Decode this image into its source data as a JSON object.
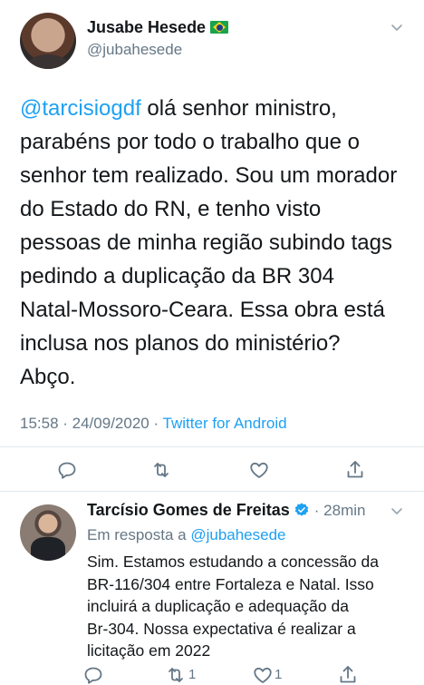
{
  "tweet": {
    "author_name": "Jusabe Hesede",
    "author_handle": "@jubahesede",
    "mention": "@tarcisiogdf",
    "text_lines": [
      " olá senhor ministro,",
      "parabéns por todo o trabalho que o",
      "senhor tem realizado. Sou um morador",
      "do Estado do RN, e tenho visto",
      "pessoas de minha região subindo tags",
      "pedindo a duplicação da BR 304",
      "Natal-Mossoro-Ceara. Essa obra está",
      "inclusa nos planos do ministério?",
      "Abço."
    ],
    "timestamp": "15:58 · 24/09/2020 · ",
    "source": "Twitter for Android",
    "icons": [
      "chevron-down-icon",
      "reply-icon",
      "retweet-icon",
      "like-icon",
      "share-icon",
      "brazil-flag-icon"
    ]
  },
  "reply": {
    "author_name": "Tarcísio Gomes de Freitas",
    "time": "· 28min",
    "replying_prefix": "Em resposta a ",
    "replying_handle": "@jubahesede",
    "text_lines": [
      "Sim. Estamos estudando a concessão da",
      "BR-116/304 entre Fortaleza e Natal. Isso",
      "incluirá a duplicação e adequação da",
      "Br-304. Nossa expectativa é realizar a",
      "licitação em 2022"
    ],
    "retweet_count": "1",
    "like_count": "1",
    "icons": [
      "verified-badge-icon",
      "chevron-down-icon",
      "reply-icon",
      "retweet-icon",
      "like-icon",
      "share-icon"
    ]
  },
  "colors": {
    "accent": "#1da1f2",
    "secondary_text": "#657786",
    "primary_text": "#14171a",
    "divider": "#e1e8ed"
  }
}
